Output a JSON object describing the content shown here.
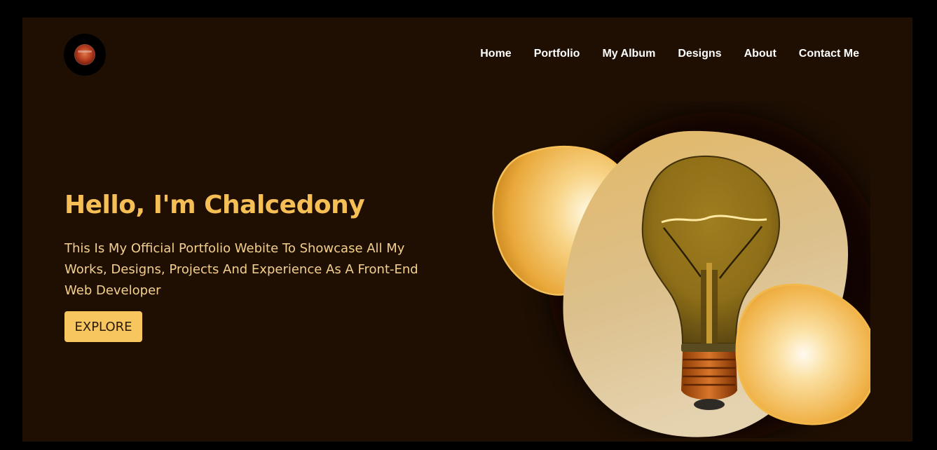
{
  "nav": {
    "items": [
      {
        "label": "Home"
      },
      {
        "label": "Portfolio"
      },
      {
        "label": "My Album"
      },
      {
        "label": "Designs"
      },
      {
        "label": "About"
      },
      {
        "label": "Contact Me"
      }
    ]
  },
  "hero": {
    "title": "Hello, I'm Chalcedony",
    "description": "This Is My Official Portfolio Webite To Showcase All My Works, Designs, Projects And Experience As A Front-End Web Developer",
    "cta_label": "EXPLORE"
  },
  "icons": {
    "logo": "logo-icon",
    "hero_image": "lightbulb-image"
  },
  "colors": {
    "background": "#1f0f03",
    "accent": "#f5bf55",
    "button": "#f7c65e",
    "nav_text": "#ffffff"
  }
}
